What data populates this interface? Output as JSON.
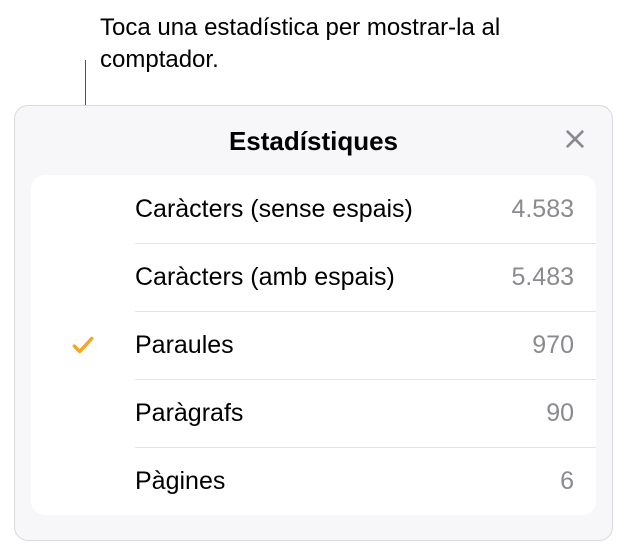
{
  "callout": {
    "text": "Toca una estadística per mostrar-la al comptador."
  },
  "panel": {
    "title": "Estadístiques"
  },
  "stats": {
    "items": [
      {
        "label": "Caràcters (sense espais)",
        "value": "4.583",
        "selected": false
      },
      {
        "label": "Caràcters (amb espais)",
        "value": "5.483",
        "selected": false
      },
      {
        "label": "Paraules",
        "value": "970",
        "selected": true
      },
      {
        "label": "Paràgrafs",
        "value": "90",
        "selected": false
      },
      {
        "label": "Pàgines",
        "value": "6",
        "selected": false
      }
    ]
  },
  "colors": {
    "accent": "#f5a623",
    "secondaryText": "#8a8a8f"
  },
  "icons": {
    "close": "close-icon",
    "check": "check-icon"
  }
}
